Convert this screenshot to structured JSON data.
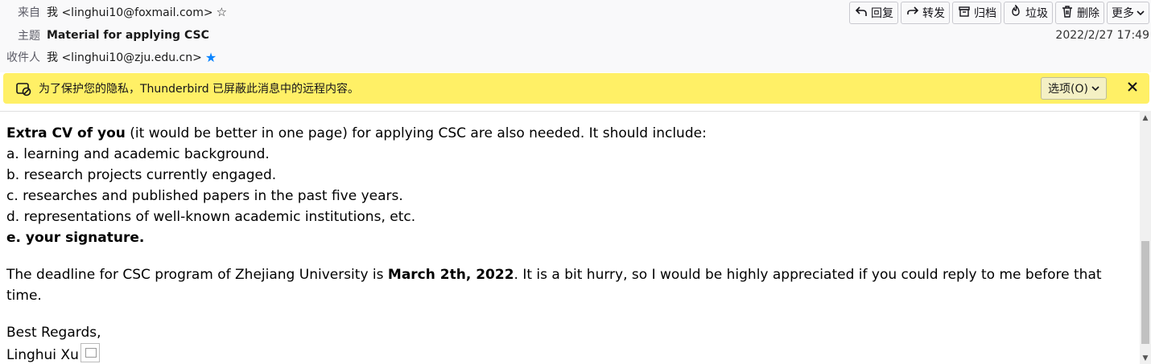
{
  "header": {
    "from_label": "来自",
    "from_value": "我 <linghui10@foxmail.com>",
    "subject_label": "主题",
    "subject_value": "Material for applying CSC",
    "to_label": "收件人",
    "to_value": "我 <linghui10@zju.edu.cn>",
    "date": "2022/2/27 17:49"
  },
  "toolbar": {
    "reply": "回复",
    "forward": "转发",
    "archive": "归档",
    "junk": "垃圾",
    "delete": "删除",
    "more": "更多"
  },
  "notice": {
    "message": "为了保护您的隐私，Thunderbird 已屏蔽此消息中的远程内容。",
    "options_label": "选项(O)"
  },
  "body": {
    "line1_bold": "Extra CV of you",
    "line1_rest": " (it would be better in one page) for applying CSC are also needed. It should include:",
    "item_a": "a. learning and academic background.",
    "item_b": "b. research projects currently engaged.",
    "item_c": "c. researches and published papers in the past five years.",
    "item_d": "d. representations of well-known academic institutions, etc.",
    "item_e": "e. your signature.",
    "deadline_pre": "The deadline for CSC program of Zhejiang University is ",
    "deadline_bold": "March 2th, 2022",
    "deadline_post": ". It is a bit hurry, so I would be highly appreciated if you could reply to me before that time.",
    "regards": "Best Regards,",
    "name": "Linghui Xu"
  },
  "colors": {
    "notice_bg": "#fff066",
    "star_blue": "#0a84ff"
  }
}
